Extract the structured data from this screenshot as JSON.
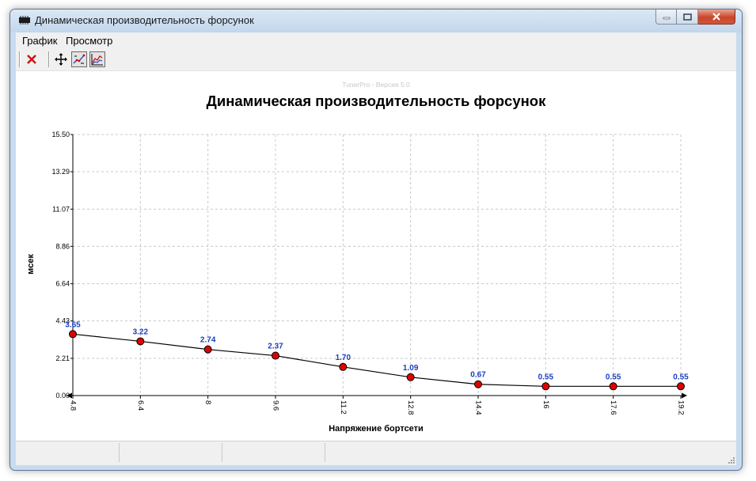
{
  "window": {
    "title": "Динамическая производительность форсунок"
  },
  "menu": [
    {
      "label": "График"
    },
    {
      "label": "Просмотр"
    }
  ],
  "toolbar": {
    "icons": [
      "delete-icon",
      "move-icon",
      "show-values-icon",
      "show-graph-icon"
    ]
  },
  "colors": {
    "point_fill": "#e00000",
    "data_label": "#1a3fbf",
    "line": "#000000",
    "grid": "#c8c8c8"
  },
  "chart_data": {
    "type": "line",
    "watermark": "TunerPro - Версия 5.0",
    "title": "Динамическая производительность форсунок",
    "xlabel": "Напряжение бортсети",
    "ylabel": "мсек",
    "x_tick_labels": [
      "4.8",
      "6.4",
      "8",
      "9.6",
      "11.2",
      "12.8",
      "14.4",
      "16",
      "17.6",
      "19.2"
    ],
    "x": [
      4.8,
      6.4,
      8,
      9.6,
      11.2,
      12.8,
      14.4,
      16,
      17.6,
      19.2
    ],
    "y_tick_labels": [
      "0.00",
      "2.21",
      "4.43",
      "6.64",
      "8.86",
      "11.07",
      "13.29",
      "15.50"
    ],
    "y_ticks": [
      0,
      2.21,
      4.43,
      6.64,
      8.86,
      11.07,
      13.29,
      15.5
    ],
    "ylim": [
      0,
      15.5
    ],
    "grid": true,
    "series": [
      {
        "values": [
          3.65,
          3.22,
          2.74,
          2.37,
          1.7,
          1.09,
          0.67,
          0.55,
          0.55,
          0.55
        ],
        "value_labels": [
          "3.65",
          "3.22",
          "2.74",
          "2.37",
          "1.70",
          "1.09",
          "0.67",
          "0.55",
          "0.55",
          "0.55"
        ]
      }
    ]
  }
}
